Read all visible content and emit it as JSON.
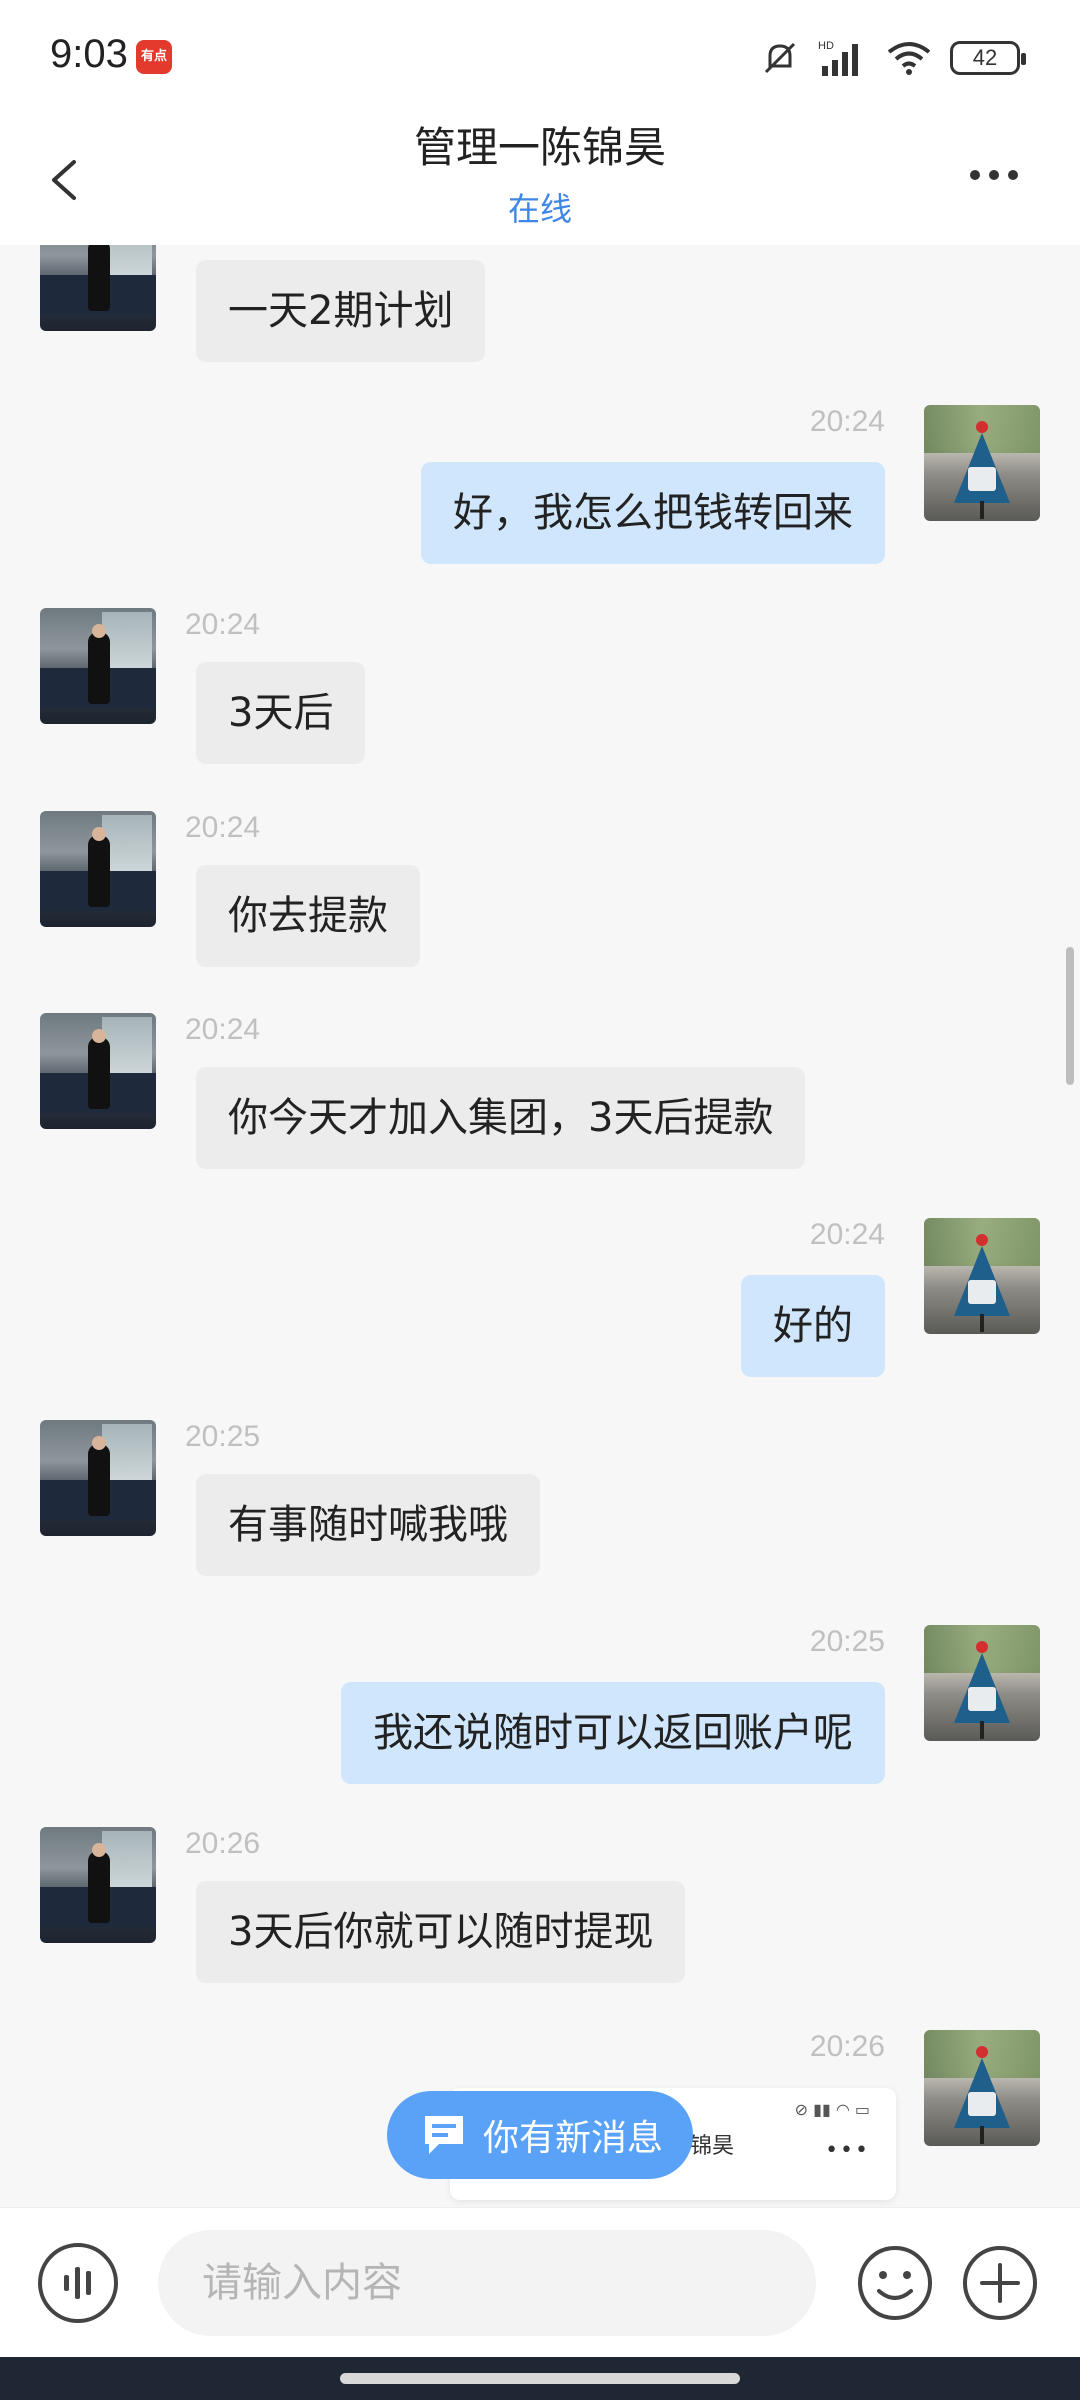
{
  "status_bar": {
    "time": "9:03",
    "app_badge": "有点",
    "battery": "42"
  },
  "header": {
    "title": "管理一陈锦昊",
    "status": "在线"
  },
  "messages": [
    {
      "side": "left",
      "time": "",
      "text": "一天2期计划"
    },
    {
      "side": "right",
      "time": "20:24",
      "text": "好，我怎么把钱转回来"
    },
    {
      "side": "left",
      "time": "20:24",
      "text": "3天后"
    },
    {
      "side": "left",
      "time": "20:24",
      "text": "你去提款"
    },
    {
      "side": "left",
      "time": "20:24",
      "text": "你今天才加入集团，3天后提款"
    },
    {
      "side": "right",
      "time": "20:24",
      "text": "好的"
    },
    {
      "side": "left",
      "time": "20:25",
      "text": "有事随时喊我哦"
    },
    {
      "side": "right",
      "time": "20:25",
      "text": "我还说随时可以返回账户呢"
    },
    {
      "side": "left",
      "time": "20:26",
      "text": "3天后你就可以随时提现"
    },
    {
      "side": "right",
      "time": "20:26",
      "text": ""
    }
  ],
  "new_message_pill": {
    "label": "你有新消息",
    "preview_name": "锦昊"
  },
  "input_bar": {
    "placeholder": "请输入内容"
  },
  "colors": {
    "accent": "#3f86e6",
    "bubble_right": "#cfe6fc",
    "bubble_left": "#ececec",
    "pill": "#5aa2f7"
  }
}
